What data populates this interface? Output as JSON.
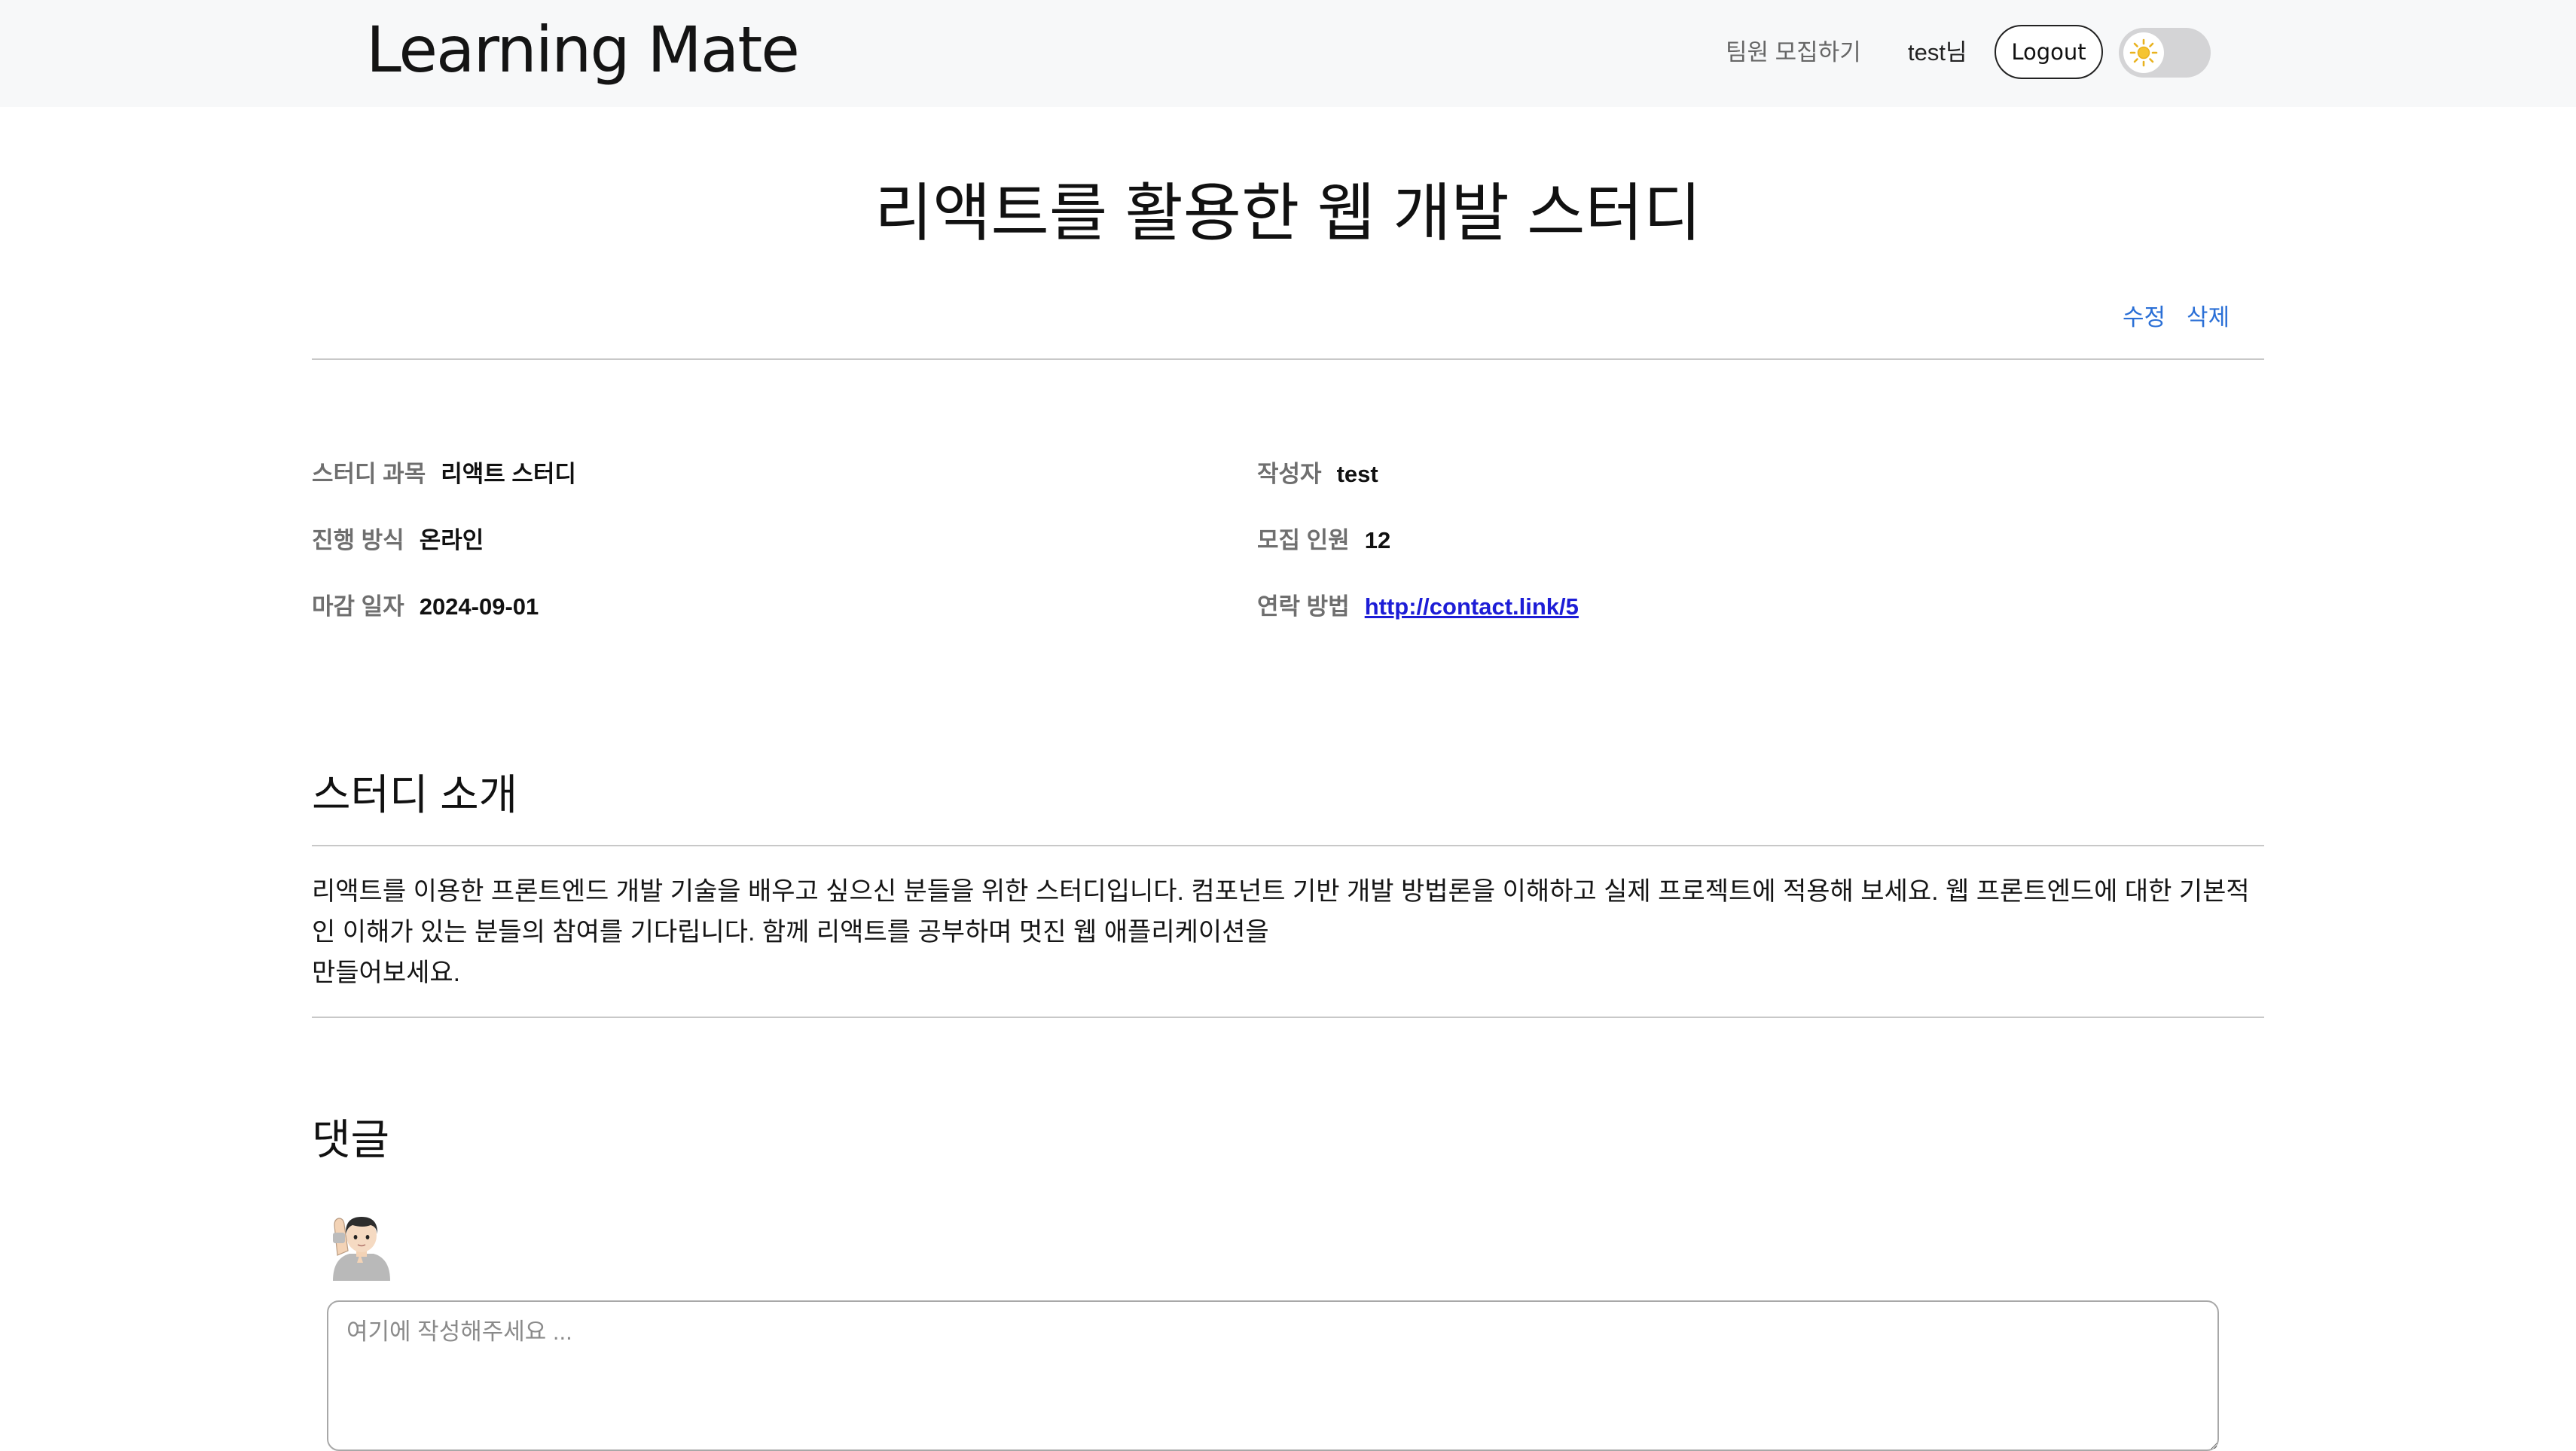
{
  "header": {
    "brand": "Learning Mate",
    "recruit_link": "팀원 모집하기",
    "user_greeting": "test님",
    "logout_label": "Logout",
    "theme_icon": "sun-icon"
  },
  "post": {
    "title": "리액트를 활용한 웹 개발 스터디",
    "edit_label": "수정",
    "delete_label": "삭제"
  },
  "info": {
    "subject_label": "스터디 과목",
    "subject_value": "리액트 스터디",
    "method_label": "진행 방식",
    "method_value": "온라인",
    "deadline_label": "마감 일자",
    "deadline_value": "2024-09-01",
    "author_label": "작성자",
    "author_value": "test",
    "headcount_label": "모집 인원",
    "headcount_value": "12",
    "contact_label": "연락 방법",
    "contact_value": "http://contact.link/5"
  },
  "intro": {
    "heading": "스터디 소개",
    "body": "리액트를 이용한 프론트엔드 개발 기술을 배우고 싶으신 분들을 위한 스터디입니다. 컴포넌트 기반 개발 방법론을 이해하고 실제 프로젝트에 적용해 보세요. 웹 프론트엔드에 대한 기본적인 이해가 있는 분들의 참여를 기다립니다. 함께 리액트를 공부하며 멋진 웹 애플리케이션을\n만들어보세요."
  },
  "comments": {
    "heading": "댓글",
    "avatar_icon": "raising-hand-avatar-icon",
    "input_placeholder": "여기에 작성해주세요 ..."
  }
}
